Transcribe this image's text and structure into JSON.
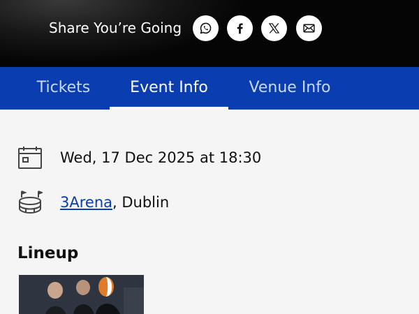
{
  "share": {
    "label": "Share You’re Going",
    "buttons": [
      {
        "name": "whatsapp",
        "icon": "whatsapp-icon"
      },
      {
        "name": "facebook",
        "icon": "facebook-icon"
      },
      {
        "name": "x",
        "icon": "x-icon"
      },
      {
        "name": "email",
        "icon": "mail-icon"
      }
    ]
  },
  "tabs": [
    {
      "label": "Tickets",
      "active": false
    },
    {
      "label": "Event Info",
      "active": true
    },
    {
      "label": "Venue Info",
      "active": false
    }
  ],
  "event": {
    "datetime": "Wed, 17 Dec 2025 at 18:30",
    "date_icon": "calendar-icon",
    "venue_name": "3Arena",
    "venue_city": ", Dublin",
    "venue_icon": "stadium-icon"
  },
  "lineup": {
    "title": "Lineup"
  },
  "colors": {
    "brand_blue": "#0a3db0",
    "hero_dark": "#050505",
    "background": "#f5f5f5"
  }
}
